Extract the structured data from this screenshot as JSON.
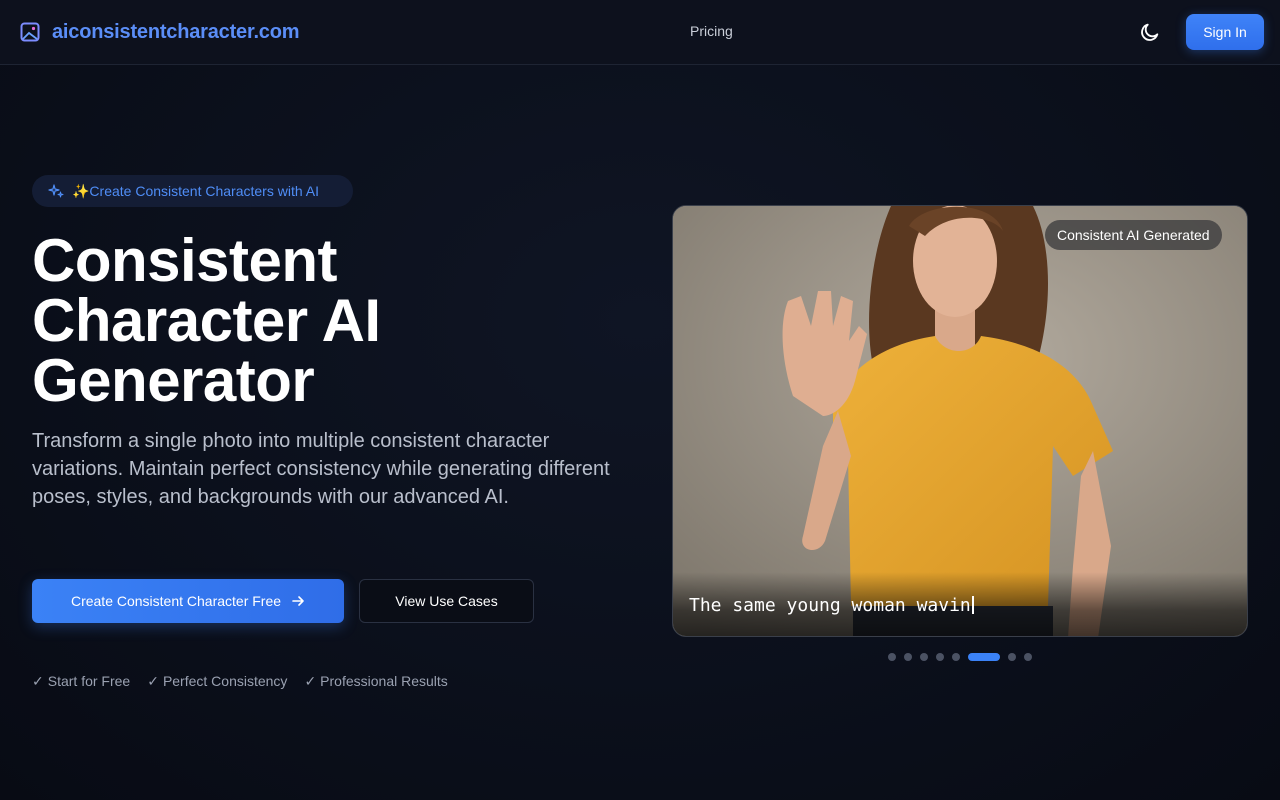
{
  "nav": {
    "brand": "aiconsistentcharacter.com",
    "links": [
      "Pricing"
    ],
    "theme_icon": "moon-icon",
    "signin_label": "Sign In"
  },
  "hero": {
    "tagline": "✨Create Consistent Characters with AI",
    "title_lines": [
      "Consistent",
      "Character AI",
      "Generator"
    ],
    "description": "Transform a single photo into multiple consistent character variations. Maintain perfect consistency while generating different poses, styles, and backgrounds with our advanced AI.",
    "primary_cta": "Create Consistent Character Free",
    "secondary_cta": "View Use Cases",
    "features": [
      "Start for Free",
      "Perfect Consistency",
      "Professional Results"
    ]
  },
  "showcase": {
    "badge": "Consistent AI Generated",
    "caption": "The same young woman wavin",
    "carousel": {
      "total": 8,
      "active_index": 5
    }
  },
  "colors": {
    "accent": "#3b82f6",
    "brand_text": "#5b8ef7",
    "background": "#0b0f1a",
    "shirt": "#e4a52b"
  }
}
